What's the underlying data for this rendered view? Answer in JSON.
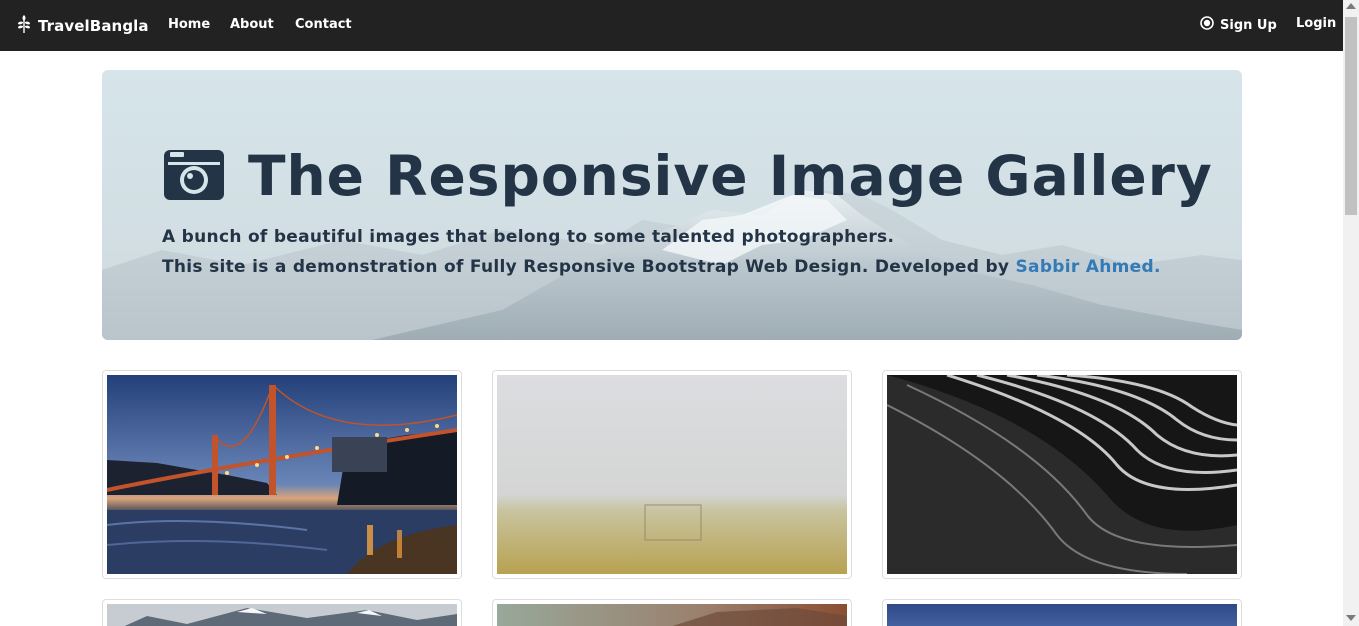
{
  "navbar": {
    "brand": "TravelBangla",
    "links": [
      "Home",
      "About",
      "Contact"
    ],
    "signup": "Sign Up",
    "login": "Login"
  },
  "hero": {
    "title": "The Responsive Image Gallery",
    "line1": "A bunch of beautiful images that belong to some talented photographers.",
    "line2_prefix": "This site is a demonstration of Fully Responsive Bootstrap Web Design. Developed by",
    "author": "Sabbir Ahmed",
    "line2_suffix": "."
  },
  "colors": {
    "navbar": "#222222",
    "title": "#243447",
    "link": "#337ab7"
  },
  "gallery": [
    {
      "icon": "golden-gate-bridge-photo"
    },
    {
      "icon": "foggy-field-goalpost-photo"
    },
    {
      "icon": "abstract-architecture-photo"
    },
    {
      "icon": "snowy-mountains-photo"
    },
    {
      "icon": "sunset-landscape-photo"
    },
    {
      "icon": "blue-sky-photo"
    }
  ]
}
